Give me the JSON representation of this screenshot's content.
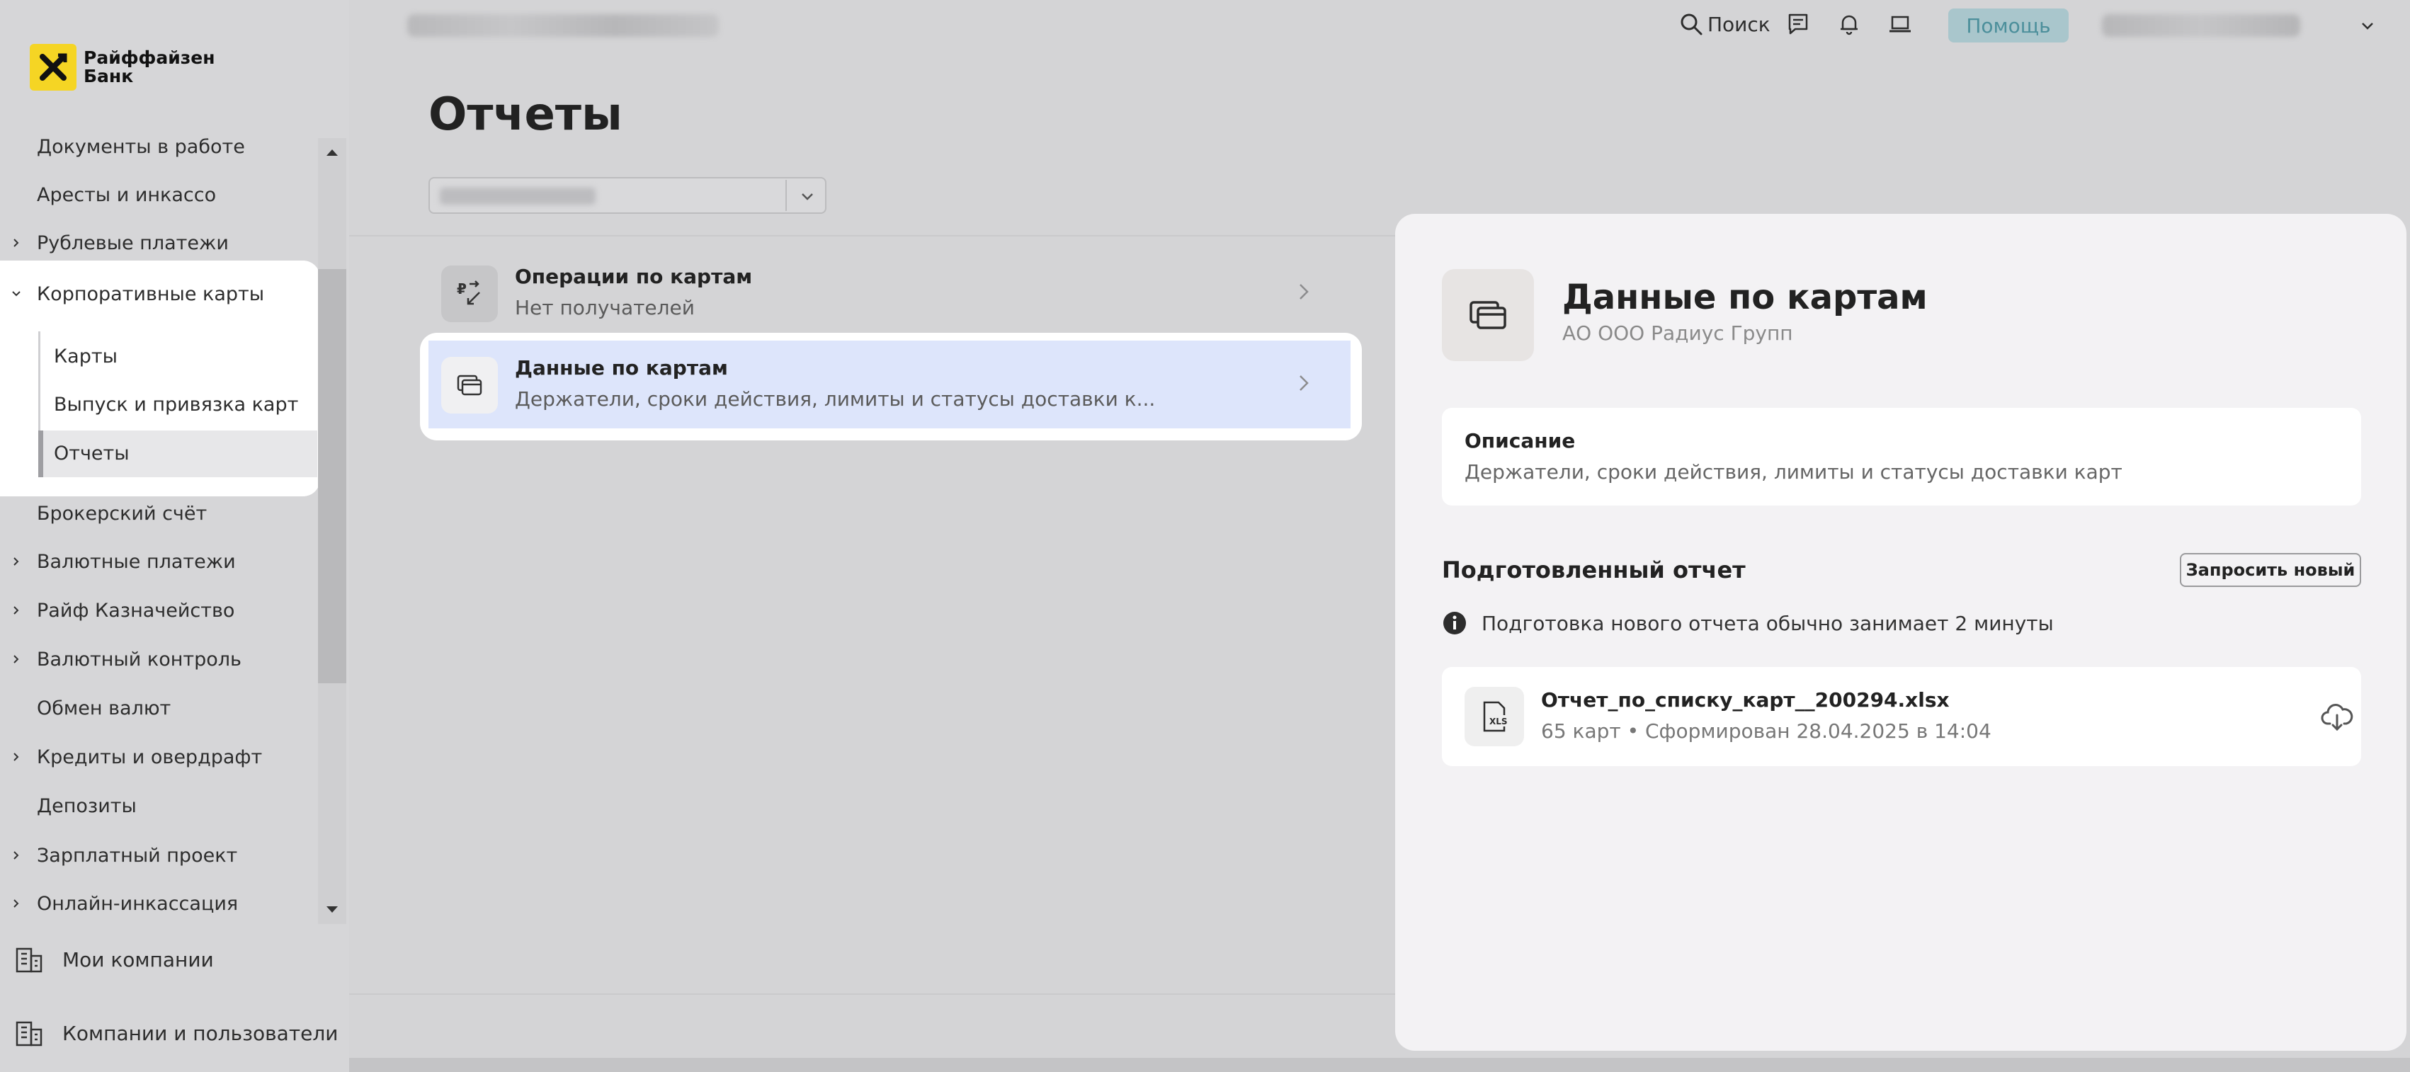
{
  "brand": {
    "name_line1": "Райффайзен",
    "name_line2": "Банк",
    "accent": "#f5d524"
  },
  "topbar": {
    "search_label": "Поиск",
    "help_label": "Помощь"
  },
  "sidebar": {
    "items": [
      {
        "label": "Документы в работе",
        "expandable": false
      },
      {
        "label": "Аресты и инкассо",
        "expandable": false
      },
      {
        "label": "Рублевые платежи",
        "expandable": true
      },
      {
        "label": "Корпоративные карты",
        "expandable": true,
        "expanded": true
      },
      {
        "label": "Карты",
        "sub": true
      },
      {
        "label": "Выпуск и привязка карт",
        "sub": true
      },
      {
        "label": "Отчеты",
        "sub": true,
        "active": true
      },
      {
        "label": "Брокерский счёт",
        "expandable": false
      },
      {
        "label": "Валютные платежи",
        "expandable": true
      },
      {
        "label": "Райф Казначейство",
        "expandable": true
      },
      {
        "label": "Валютный контроль",
        "expandable": true
      },
      {
        "label": "Обмен валют",
        "expandable": false
      },
      {
        "label": "Кредиты и овердрафт",
        "expandable": true
      },
      {
        "label": "Депозиты",
        "expandable": false
      },
      {
        "label": "Зарплатный проект",
        "expandable": true
      },
      {
        "label": "Онлайн-инкассация",
        "expandable": true
      }
    ],
    "bottom": {
      "my_companies": "Мои компании",
      "companies_users": "Компании и пользователи"
    }
  },
  "main": {
    "title": "Отчеты",
    "reports": [
      {
        "title": "Операции по картам",
        "desc": "Нет получателей"
      },
      {
        "title": "Данные по картам",
        "desc": "Держатели, сроки действия, лимиты и статусы доставки к..."
      }
    ]
  },
  "panel": {
    "title": "Данные по картам",
    "company": "АО ООО Радиус Групп",
    "description_heading": "Описание",
    "description_text": "Держатели, сроки действия, лимиты и статусы доставки карт",
    "prepared_heading": "Подготовленный отчет",
    "request_button": "Запросить новый",
    "info_text": "Подготовка нового отчета обычно занимает 2 минуты",
    "file": {
      "name": "Отчет_по_списку_карт__200294.xlsx",
      "meta": "65 карт • Сформирован 28.04.2025 в 14:04",
      "badge": "XLS"
    }
  }
}
